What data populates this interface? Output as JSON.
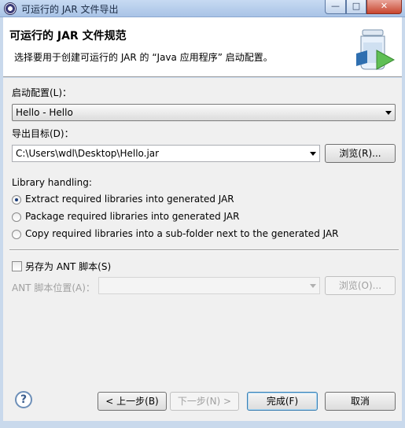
{
  "window": {
    "title": "可运行的 JAR 文件导出",
    "minimize_glyph": "—",
    "maximize_glyph": "□",
    "close_glyph": "✕"
  },
  "header": {
    "title": "可运行的 JAR 文件规范",
    "description": "选择要用于创建可运行的 JAR 的 “Java 应用程序” 启动配置。",
    "graphic_icon": "jar-export-icon"
  },
  "launch_config": {
    "label": "启动配置(L)：",
    "value": "Hello - Hello"
  },
  "export_target": {
    "label": "导出目标(D)：",
    "value": "C:\\Users\\wdl\\Desktop\\Hello.jar",
    "browse_label": "浏览(R)..."
  },
  "library_handling": {
    "label": "Library handling:",
    "options": [
      {
        "label": "Extract required libraries into generated JAR",
        "checked": true
      },
      {
        "label": "Package required libraries into generated JAR",
        "checked": false
      },
      {
        "label": "Copy required libraries into a sub-folder next to the generated JAR",
        "checked": false
      }
    ]
  },
  "ant": {
    "save_label": "另存为 ANT 脚本(S)",
    "checked": false,
    "location_label": "ANT 脚本位置(A)：",
    "location_value": "",
    "browse_label": "浏览(O)..."
  },
  "footer": {
    "help_glyph": "?",
    "back_label": "< 上一步(B)",
    "next_label": "下一步(N) >",
    "finish_label": "完成(F)",
    "cancel_label": "取消"
  }
}
